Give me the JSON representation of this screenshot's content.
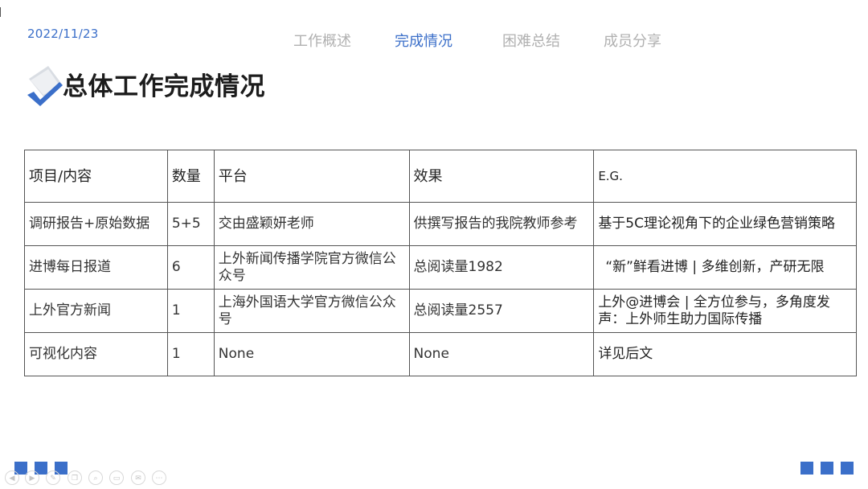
{
  "date": "2022/11/23",
  "nav": {
    "tabs": [
      {
        "label": "工作概述",
        "active": false
      },
      {
        "label": "完成情况",
        "active": true
      },
      {
        "label": "困难总结",
        "active": false
      },
      {
        "label": "成员分享",
        "active": false
      }
    ]
  },
  "title": "总体工作完成情况",
  "table": {
    "headers": [
      "项目/内容",
      "数量",
      "平台",
      "效果",
      "E.G."
    ],
    "rows": [
      [
        "调研报告+原始数据",
        "5+5",
        "交由盛颖妍老师",
        "供撰写报告的我院教师参考",
        "基于5C理论视角下的企业绿色营销策略"
      ],
      [
        "进博每日报道",
        "6",
        "上外新闻传播学院官方微信公众号",
        "总阅读量1982",
        "“新”鲜看进博 | 多维创新，产研无限"
      ],
      [
        "上外官方新闻",
        "1",
        "上海外国语大学官方微信公众号",
        "总阅读量2557",
        "上外@进博会 | 全方位参与，多角度发声：上外师生助力国际传播"
      ],
      [
        "可视化内容",
        "1",
        "None",
        "None",
        "详见后文"
      ]
    ]
  },
  "colors": {
    "accent": "#3b6fc9",
    "inactive_tab": "#b0b0b0"
  },
  "controls": [
    "prev-icon",
    "next-icon",
    "pen-icon",
    "copy-icon",
    "zoom-icon",
    "screen-icon",
    "mail-icon",
    "more-icon"
  ]
}
